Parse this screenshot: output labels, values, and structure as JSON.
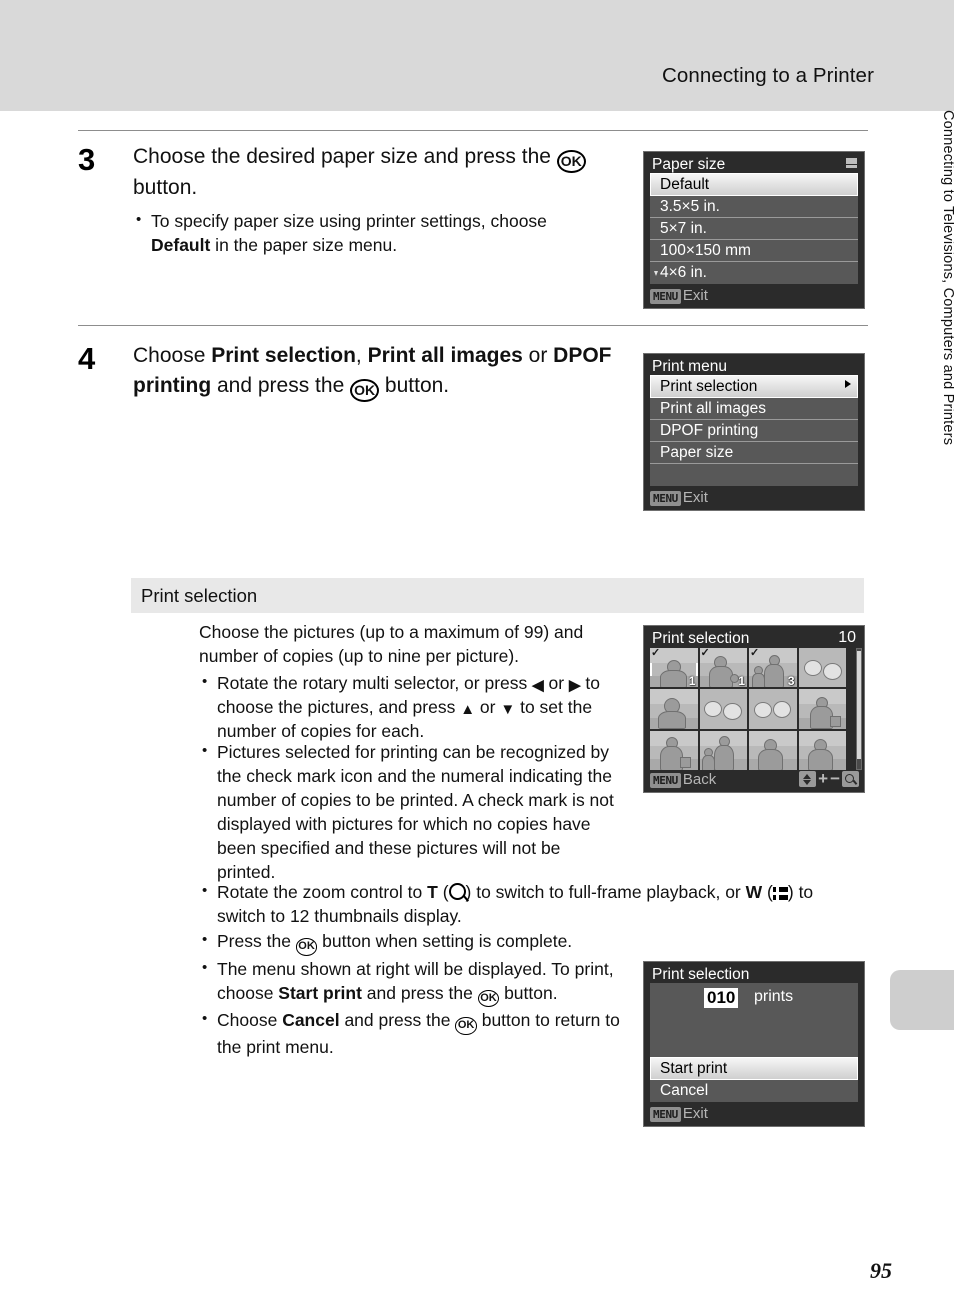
{
  "header": {
    "title": "Connecting to a Printer"
  },
  "steps": [
    {
      "number": "3",
      "heading_part1": "Choose the desired paper size and press the ",
      "heading_ok": "OK",
      "heading_part2": " button.",
      "bullets": [
        {
          "text_part1": "To specify paper size using printer settings, choose ",
          "bold": "Default",
          "text_part2": " in the paper size menu."
        }
      ]
    },
    {
      "number": "4",
      "heading_part1": "Choose ",
      "bold1": "Print selection",
      "heading_part2": ", ",
      "bold2": "Print all images",
      "heading_part3": " or ",
      "bold3": "DPOF printing",
      "heading_part4": " and press the ",
      "heading_ok": "OK",
      "heading_part5": " button."
    }
  ],
  "section": {
    "title": "Print selection",
    "intro": "Choose the pictures (up to a maximum of 99) and number of copies (up to nine per picture).",
    "bullets": [
      {
        "parts": [
          "Rotate the rotary multi selector, or press ",
          "◀",
          " or ",
          "▶",
          " to choose the pictures, and press ",
          "▲",
          " or ",
          "▼",
          " to set the number of copies for each."
        ]
      },
      {
        "text": "Pictures selected for printing can be recognized by the check mark icon and the numeral indicating the number of copies to be printed. A check mark is not displayed with pictures for which no copies have been specified and these pictures will not be printed."
      },
      {
        "parts": [
          "Rotate the zoom control to ",
          "T",
          " (",
          "magnifier-icon",
          ") to switch to full-frame playback, or ",
          "W",
          " (",
          "thumbnail-icon",
          ") to switch to 12 thumbnails display."
        ]
      },
      {
        "parts": [
          "Press the ",
          "OK",
          " button when setting is complete."
        ]
      },
      {
        "parts": [
          "The menu shown at right will be displayed. To print, choose ",
          "Start print",
          " and press the ",
          "OK",
          " button."
        ]
      },
      {
        "parts": [
          "Choose ",
          "Cancel",
          " and press the ",
          "OK",
          " button to return to the print menu."
        ]
      }
    ]
  },
  "screens": {
    "paper_size": {
      "title": "Paper size",
      "items": [
        {
          "label": "Default",
          "selected": true
        },
        {
          "label": "3.5×5 in.",
          "selected": false
        },
        {
          "label": "5×7 in.",
          "selected": false
        },
        {
          "label": "100×150 mm",
          "selected": false
        },
        {
          "label": "4×6 in.",
          "selected": false,
          "partial": true
        }
      ],
      "footer_badge": "MENU",
      "footer_label": "Exit"
    },
    "print_menu": {
      "title": "Print menu",
      "items": [
        {
          "label": "Print selection",
          "selected": true,
          "has_arrow": true
        },
        {
          "label": "Print all images",
          "selected": false
        },
        {
          "label": "DPOF printing",
          "selected": false
        },
        {
          "label": "Paper size",
          "selected": false
        }
      ],
      "footer_badge": "MENU",
      "footer_label": "Exit"
    },
    "print_selection_thumbs": {
      "title": "Print selection",
      "count": "10",
      "thumbnails": [
        {
          "index": 1,
          "checked": true,
          "copies": "1",
          "selected": true,
          "kind": "person-landscape"
        },
        {
          "index": 2,
          "checked": true,
          "copies": "1",
          "selected": false,
          "kind": "two-people"
        },
        {
          "index": 3,
          "checked": true,
          "copies": "3",
          "selected": false,
          "kind": "family"
        },
        {
          "index": 4,
          "checked": false,
          "copies": "",
          "selected": false,
          "kind": "flowers"
        },
        {
          "index": 5,
          "checked": false,
          "copies": "",
          "selected": false,
          "kind": "portrait"
        },
        {
          "index": 6,
          "checked": false,
          "copies": "",
          "selected": false,
          "kind": "flowers"
        },
        {
          "index": 7,
          "checked": false,
          "copies": "",
          "selected": false,
          "kind": "flowers"
        },
        {
          "index": 8,
          "checked": false,
          "copies": "",
          "selected": false,
          "kind": "person-bag"
        },
        {
          "index": 9,
          "checked": false,
          "copies": "",
          "selected": false,
          "kind": "person-bag"
        },
        {
          "index": 10,
          "checked": false,
          "copies": "",
          "selected": false,
          "kind": "family"
        },
        {
          "index": 11,
          "checked": false,
          "copies": "",
          "selected": false,
          "kind": "person-landscape"
        },
        {
          "index": 12,
          "checked": false,
          "copies": "",
          "selected": false,
          "kind": "person-landscape"
        }
      ],
      "footer_badge": "MENU",
      "footer_label": "Back",
      "footer_icons": [
        "up-down-icon",
        "plus-icon",
        "minus-icon",
        "magnifier-icon"
      ]
    },
    "print_selection_confirm": {
      "title": "Print selection",
      "count_value": "010",
      "count_label": "prints",
      "items": [
        {
          "label": "Start print",
          "selected": true
        },
        {
          "label": "Cancel",
          "selected": false
        }
      ],
      "footer_badge": "MENU",
      "footer_label": "Exit"
    }
  },
  "side_tab": {
    "text": "Connecting to Televisions, Computers and Printers"
  },
  "page_number": "95"
}
